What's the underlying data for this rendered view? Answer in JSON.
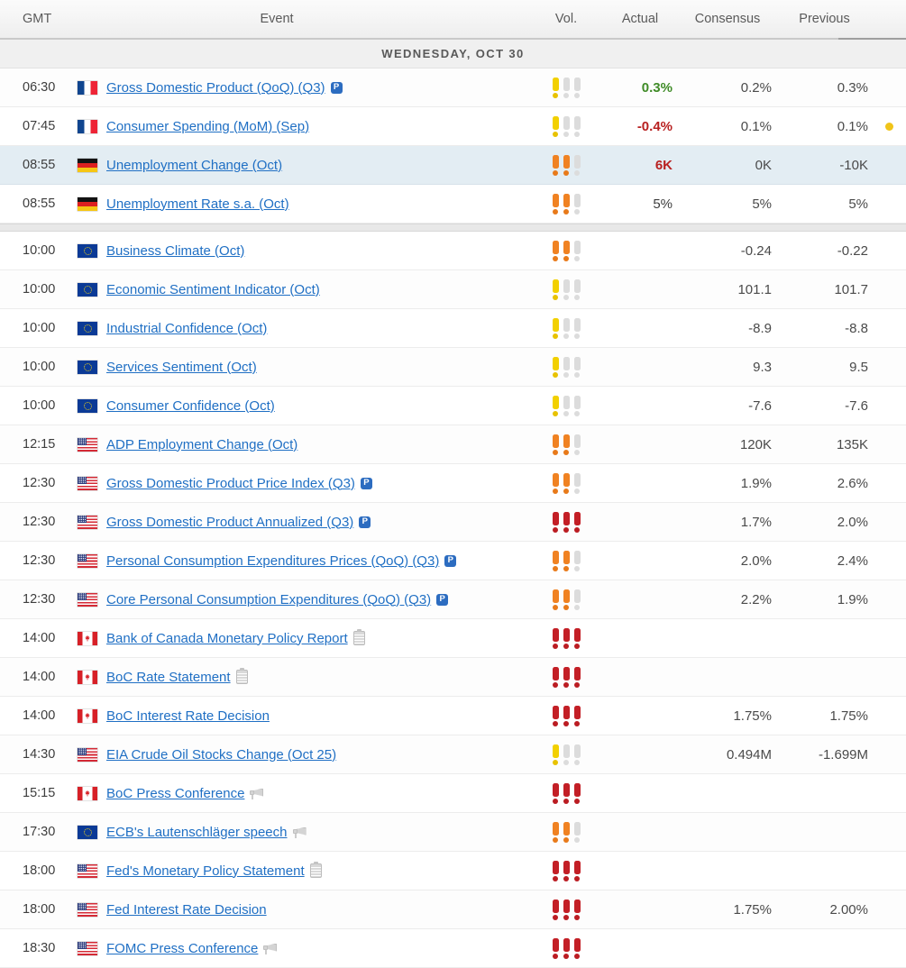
{
  "header": {
    "gmt": "GMT",
    "event": "Event",
    "vol": "Vol.",
    "actual": "Actual",
    "consensus": "Consensus",
    "previous": "Previous"
  },
  "day_separator": "WEDNESDAY, OCT 30",
  "colors": {
    "link": "#1f6fc4",
    "actual_up": "#3f8b27",
    "actual_down": "#b82121",
    "vol_low": "#f2d000",
    "vol_medium": "#f08222",
    "vol_high": "#c31f26",
    "vol_inactive": "#dcdcdc",
    "row_highlight": "#e3edf3",
    "revision_dot": "#f0c419"
  },
  "rows": [
    {
      "time": "06:30",
      "flag": "fr",
      "event": "Gross Domestic Product (QoQ) (Q3)",
      "badge": "P",
      "icon": null,
      "vol": 1,
      "actual": "0.3%",
      "actual_state": "up",
      "consensus": "0.2%",
      "previous": "0.3%",
      "dot": false,
      "highlight": false
    },
    {
      "time": "07:45",
      "flag": "fr",
      "event": "Consumer Spending (MoM) (Sep)",
      "badge": null,
      "icon": null,
      "vol": 1,
      "actual": "-0.4%",
      "actual_state": "down",
      "consensus": "0.1%",
      "previous": "0.1%",
      "dot": true,
      "highlight": false
    },
    {
      "time": "08:55",
      "flag": "de",
      "event": "Unemployment Change (Oct)",
      "badge": null,
      "icon": null,
      "vol": 2,
      "actual": "6K",
      "actual_state": "down",
      "consensus": "0K",
      "previous": "-10K",
      "dot": false,
      "highlight": true
    },
    {
      "time": "08:55",
      "flag": "de",
      "event": "Unemployment Rate s.a. (Oct)",
      "badge": null,
      "icon": null,
      "vol": 2,
      "actual": "5%",
      "actual_state": "plain",
      "consensus": "5%",
      "previous": "5%",
      "dot": false,
      "highlight": false
    },
    {
      "gap": true
    },
    {
      "time": "10:00",
      "flag": "eu",
      "event": "Business Climate (Oct)",
      "badge": null,
      "icon": null,
      "vol": 2,
      "actual": "",
      "actual_state": "plain",
      "consensus": "-0.24",
      "previous": "-0.22",
      "dot": false,
      "highlight": false
    },
    {
      "time": "10:00",
      "flag": "eu",
      "event": "Economic Sentiment Indicator (Oct)",
      "badge": null,
      "icon": null,
      "vol": 1,
      "actual": "",
      "actual_state": "plain",
      "consensus": "101.1",
      "previous": "101.7",
      "dot": false,
      "highlight": false
    },
    {
      "time": "10:00",
      "flag": "eu",
      "event": "Industrial Confidence (Oct)",
      "badge": null,
      "icon": null,
      "vol": 1,
      "actual": "",
      "actual_state": "plain",
      "consensus": "-8.9",
      "previous": "-8.8",
      "dot": false,
      "highlight": false
    },
    {
      "time": "10:00",
      "flag": "eu",
      "event": "Services Sentiment (Oct)",
      "badge": null,
      "icon": null,
      "vol": 1,
      "actual": "",
      "actual_state": "plain",
      "consensus": "9.3",
      "previous": "9.5",
      "dot": false,
      "highlight": false
    },
    {
      "time": "10:00",
      "flag": "eu",
      "event": "Consumer Confidence (Oct)",
      "badge": null,
      "icon": null,
      "vol": 1,
      "actual": "",
      "actual_state": "plain",
      "consensus": "-7.6",
      "previous": "-7.6",
      "dot": false,
      "highlight": false
    },
    {
      "time": "12:15",
      "flag": "us",
      "event": "ADP Employment Change (Oct)",
      "badge": null,
      "icon": null,
      "vol": 2,
      "actual": "",
      "actual_state": "plain",
      "consensus": "120K",
      "previous": "135K",
      "dot": false,
      "highlight": false
    },
    {
      "time": "12:30",
      "flag": "us",
      "event": "Gross Domestic Product Price Index (Q3)",
      "badge": "P",
      "icon": null,
      "vol": 2,
      "actual": "",
      "actual_state": "plain",
      "consensus": "1.9%",
      "previous": "2.6%",
      "dot": false,
      "highlight": false
    },
    {
      "time": "12:30",
      "flag": "us",
      "event": "Gross Domestic Product Annualized (Q3)",
      "badge": "P",
      "icon": null,
      "vol": 3,
      "actual": "",
      "actual_state": "plain",
      "consensus": "1.7%",
      "previous": "2.0%",
      "dot": false,
      "highlight": false
    },
    {
      "time": "12:30",
      "flag": "us",
      "event": "Personal Consumption Expenditures Prices (QoQ) (Q3)",
      "badge": "P",
      "icon": null,
      "vol": 2,
      "actual": "",
      "actual_state": "plain",
      "consensus": "2.0%",
      "previous": "2.4%",
      "dot": false,
      "highlight": false
    },
    {
      "time": "12:30",
      "flag": "us",
      "event": "Core Personal Consumption Expenditures (QoQ) (Q3)",
      "badge": "P",
      "icon": null,
      "vol": 2,
      "actual": "",
      "actual_state": "plain",
      "consensus": "2.2%",
      "previous": "1.9%",
      "dot": false,
      "highlight": false
    },
    {
      "time": "14:00",
      "flag": "ca",
      "event": "Bank of Canada Monetary Policy Report",
      "badge": null,
      "icon": "document-icon",
      "vol": 3,
      "actual": "",
      "actual_state": "plain",
      "consensus": "",
      "previous": "",
      "dot": false,
      "highlight": false
    },
    {
      "time": "14:00",
      "flag": "ca",
      "event": "BoC Rate Statement",
      "badge": null,
      "icon": "document-icon",
      "vol": 3,
      "actual": "",
      "actual_state": "plain",
      "consensus": "",
      "previous": "",
      "dot": false,
      "highlight": false
    },
    {
      "time": "14:00",
      "flag": "ca",
      "event": "BoC Interest Rate Decision",
      "badge": null,
      "icon": null,
      "vol": 3,
      "actual": "",
      "actual_state": "plain",
      "consensus": "1.75%",
      "previous": "1.75%",
      "dot": false,
      "highlight": false
    },
    {
      "time": "14:30",
      "flag": "us",
      "event": "EIA Crude Oil Stocks Change (Oct 25)",
      "badge": null,
      "icon": null,
      "vol": 1,
      "actual": "",
      "actual_state": "plain",
      "consensus": "0.494M",
      "previous": "-1.699M",
      "dot": false,
      "highlight": false
    },
    {
      "time": "15:15",
      "flag": "ca",
      "event": "BoC Press Conference",
      "badge": null,
      "icon": "megaphone-icon",
      "vol": 3,
      "actual": "",
      "actual_state": "plain",
      "consensus": "",
      "previous": "",
      "dot": false,
      "highlight": false
    },
    {
      "time": "17:30",
      "flag": "eu",
      "event": "ECB's Lautenschläger speech",
      "badge": null,
      "icon": "megaphone-icon",
      "vol": 2,
      "actual": "",
      "actual_state": "plain",
      "consensus": "",
      "previous": "",
      "dot": false,
      "highlight": false
    },
    {
      "time": "18:00",
      "flag": "us",
      "event": "Fed's Monetary Policy Statement",
      "badge": null,
      "icon": "document-icon",
      "vol": 3,
      "actual": "",
      "actual_state": "plain",
      "consensus": "",
      "previous": "",
      "dot": false,
      "highlight": false
    },
    {
      "time": "18:00",
      "flag": "us",
      "event": "Fed Interest Rate Decision",
      "badge": null,
      "icon": null,
      "vol": 3,
      "actual": "",
      "actual_state": "plain",
      "consensus": "1.75%",
      "previous": "2.00%",
      "dot": false,
      "highlight": false
    },
    {
      "time": "18:30",
      "flag": "us",
      "event": "FOMC Press Conference",
      "badge": null,
      "icon": "megaphone-icon",
      "vol": 3,
      "actual": "",
      "actual_state": "plain",
      "consensus": "",
      "previous": "",
      "dot": false,
      "highlight": false
    }
  ]
}
